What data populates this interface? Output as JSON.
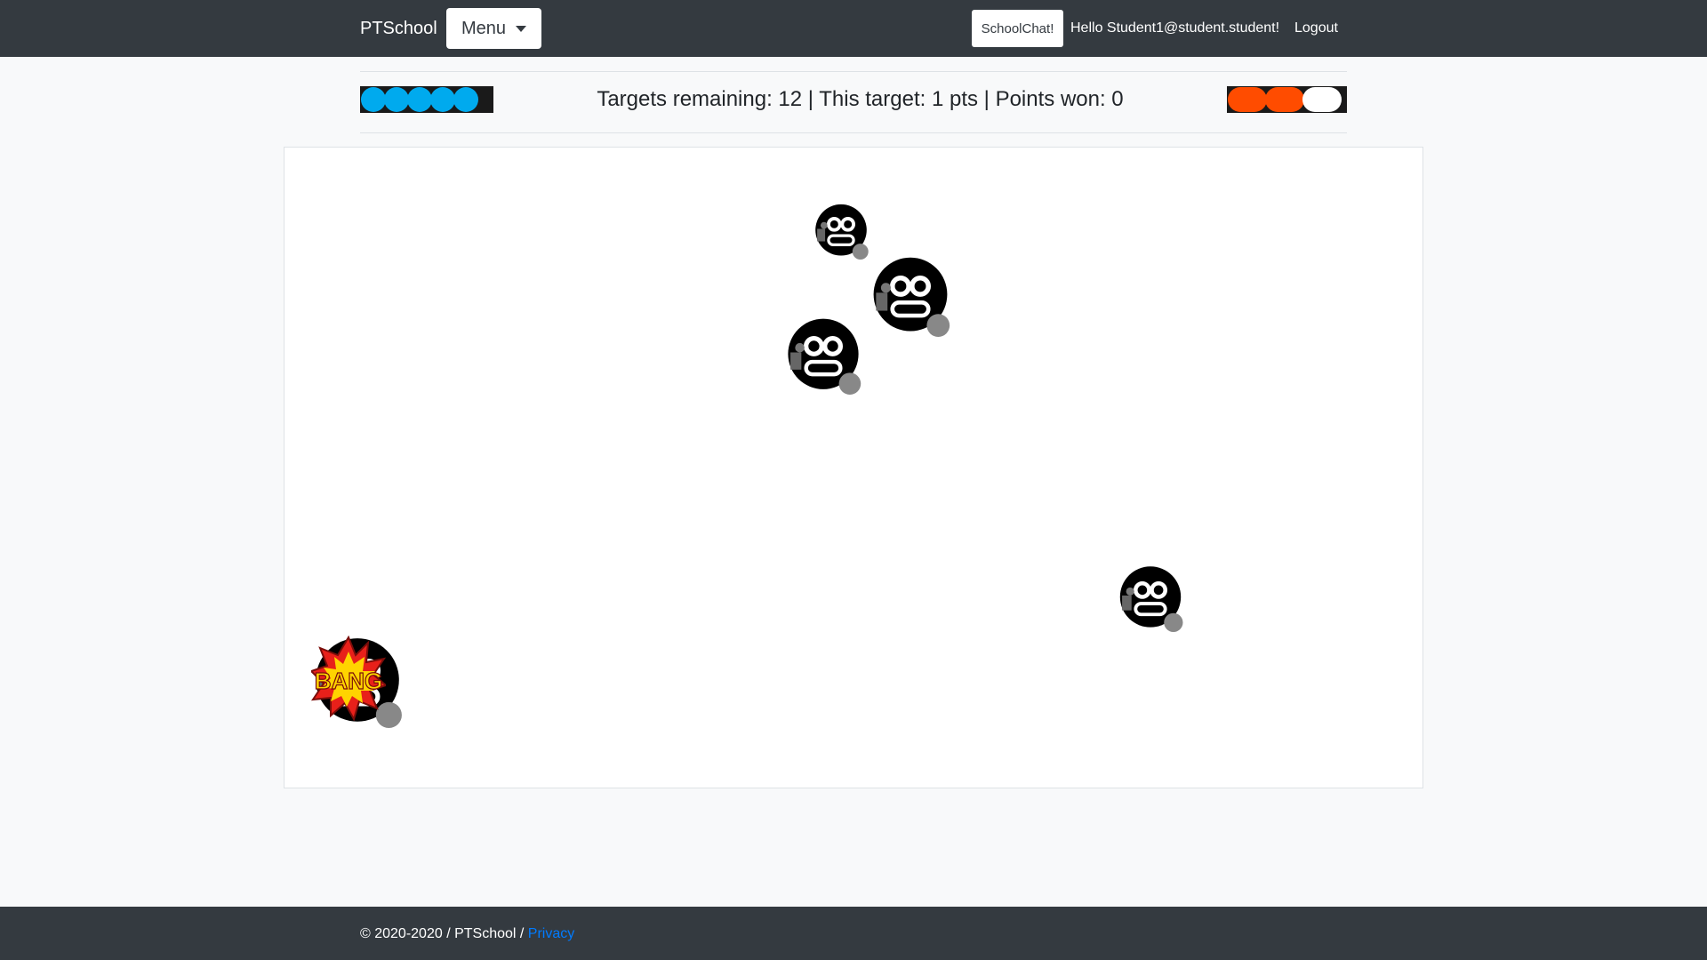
{
  "nav": {
    "brand": "PTSchool",
    "menu_label": "Menu",
    "chat_label": "SchoolChat!",
    "greeting": "Hello Student1@student.student!",
    "logout_label": "Logout"
  },
  "hud": {
    "status_text": "Targets remaining: 12 | This target: 1 pts | Points won: 0",
    "targets_remaining": 12,
    "this_target_pts": 1,
    "points_won": 0,
    "left_indicator": {
      "color": "#00aaee",
      "count": 5,
      "filled": 5
    },
    "right_indicator": {
      "filled_color": "#ff4c00",
      "empty_color": "#ffffff",
      "count": 3,
      "filled": 2
    }
  },
  "game": {
    "target_icon": "grimace-face-icon",
    "hit_icon": "bang-burst-icon",
    "hit_text": "BANG",
    "targets_visible": 5,
    "hit_targets": 1
  },
  "footer": {
    "copyright": "© 2020-2020 / PTSchool / ",
    "privacy_label": "Privacy"
  },
  "colors": {
    "navbar": "#343a40",
    "link": "#007bff"
  }
}
